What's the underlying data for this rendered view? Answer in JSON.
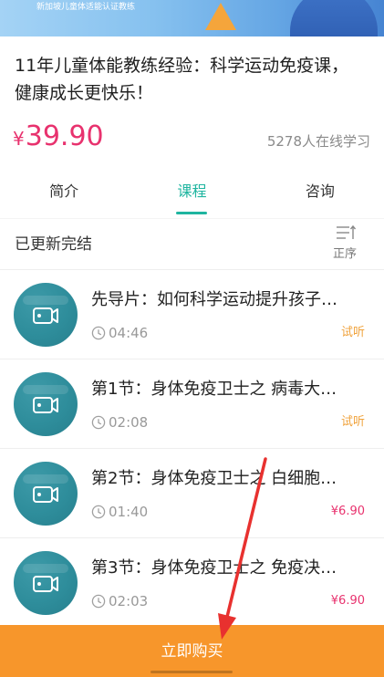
{
  "banner": {
    "caption": "新加坡儿童体适能认证教练"
  },
  "course": {
    "title": "11年儿童体能教练经验：科学运动免疫课，健康成长更快乐！",
    "price_symbol": "¥",
    "price": "39.90",
    "learners": "5278人在线学习"
  },
  "tabs": [
    {
      "label": "简介",
      "active": false
    },
    {
      "label": "课程",
      "active": true
    },
    {
      "label": "咨询",
      "active": false
    }
  ],
  "lessons_header": {
    "status": "已更新完结",
    "sort_label": "正序",
    "sort_icon": "sort-icon"
  },
  "lessons": [
    {
      "title": "先导片：如何科学运动提升孩子…",
      "duration": "04:46",
      "tag": "试听",
      "tag_color": "#f0a23b",
      "icon": "video-camera-icon"
    },
    {
      "title": "第1节：身体免疫卫士之 病毒大…",
      "duration": "02:08",
      "tag": "试听",
      "tag_color": "#f0a23b",
      "icon": "video-camera-icon"
    },
    {
      "title": "第2节：身体免疫卫士之 白细胞…",
      "duration": "01:40",
      "tag": "¥6.90",
      "tag_color": "#e8326e",
      "icon": "video-camera-icon"
    },
    {
      "title": "第3节：身体免疫卫士之 免疫决…",
      "duration": "02:03",
      "tag": "¥6.90",
      "tag_color": "#e8326e",
      "icon": "video-camera-icon"
    }
  ],
  "buy_button": {
    "label": "立即购买"
  },
  "colors": {
    "accent": "#1fb5a0",
    "price": "#e8326e",
    "preview": "#f0a23b",
    "buy_button": "#f7962b",
    "thumbnail": "#2e8d9b",
    "annotation_arrow": "#e8312f"
  }
}
